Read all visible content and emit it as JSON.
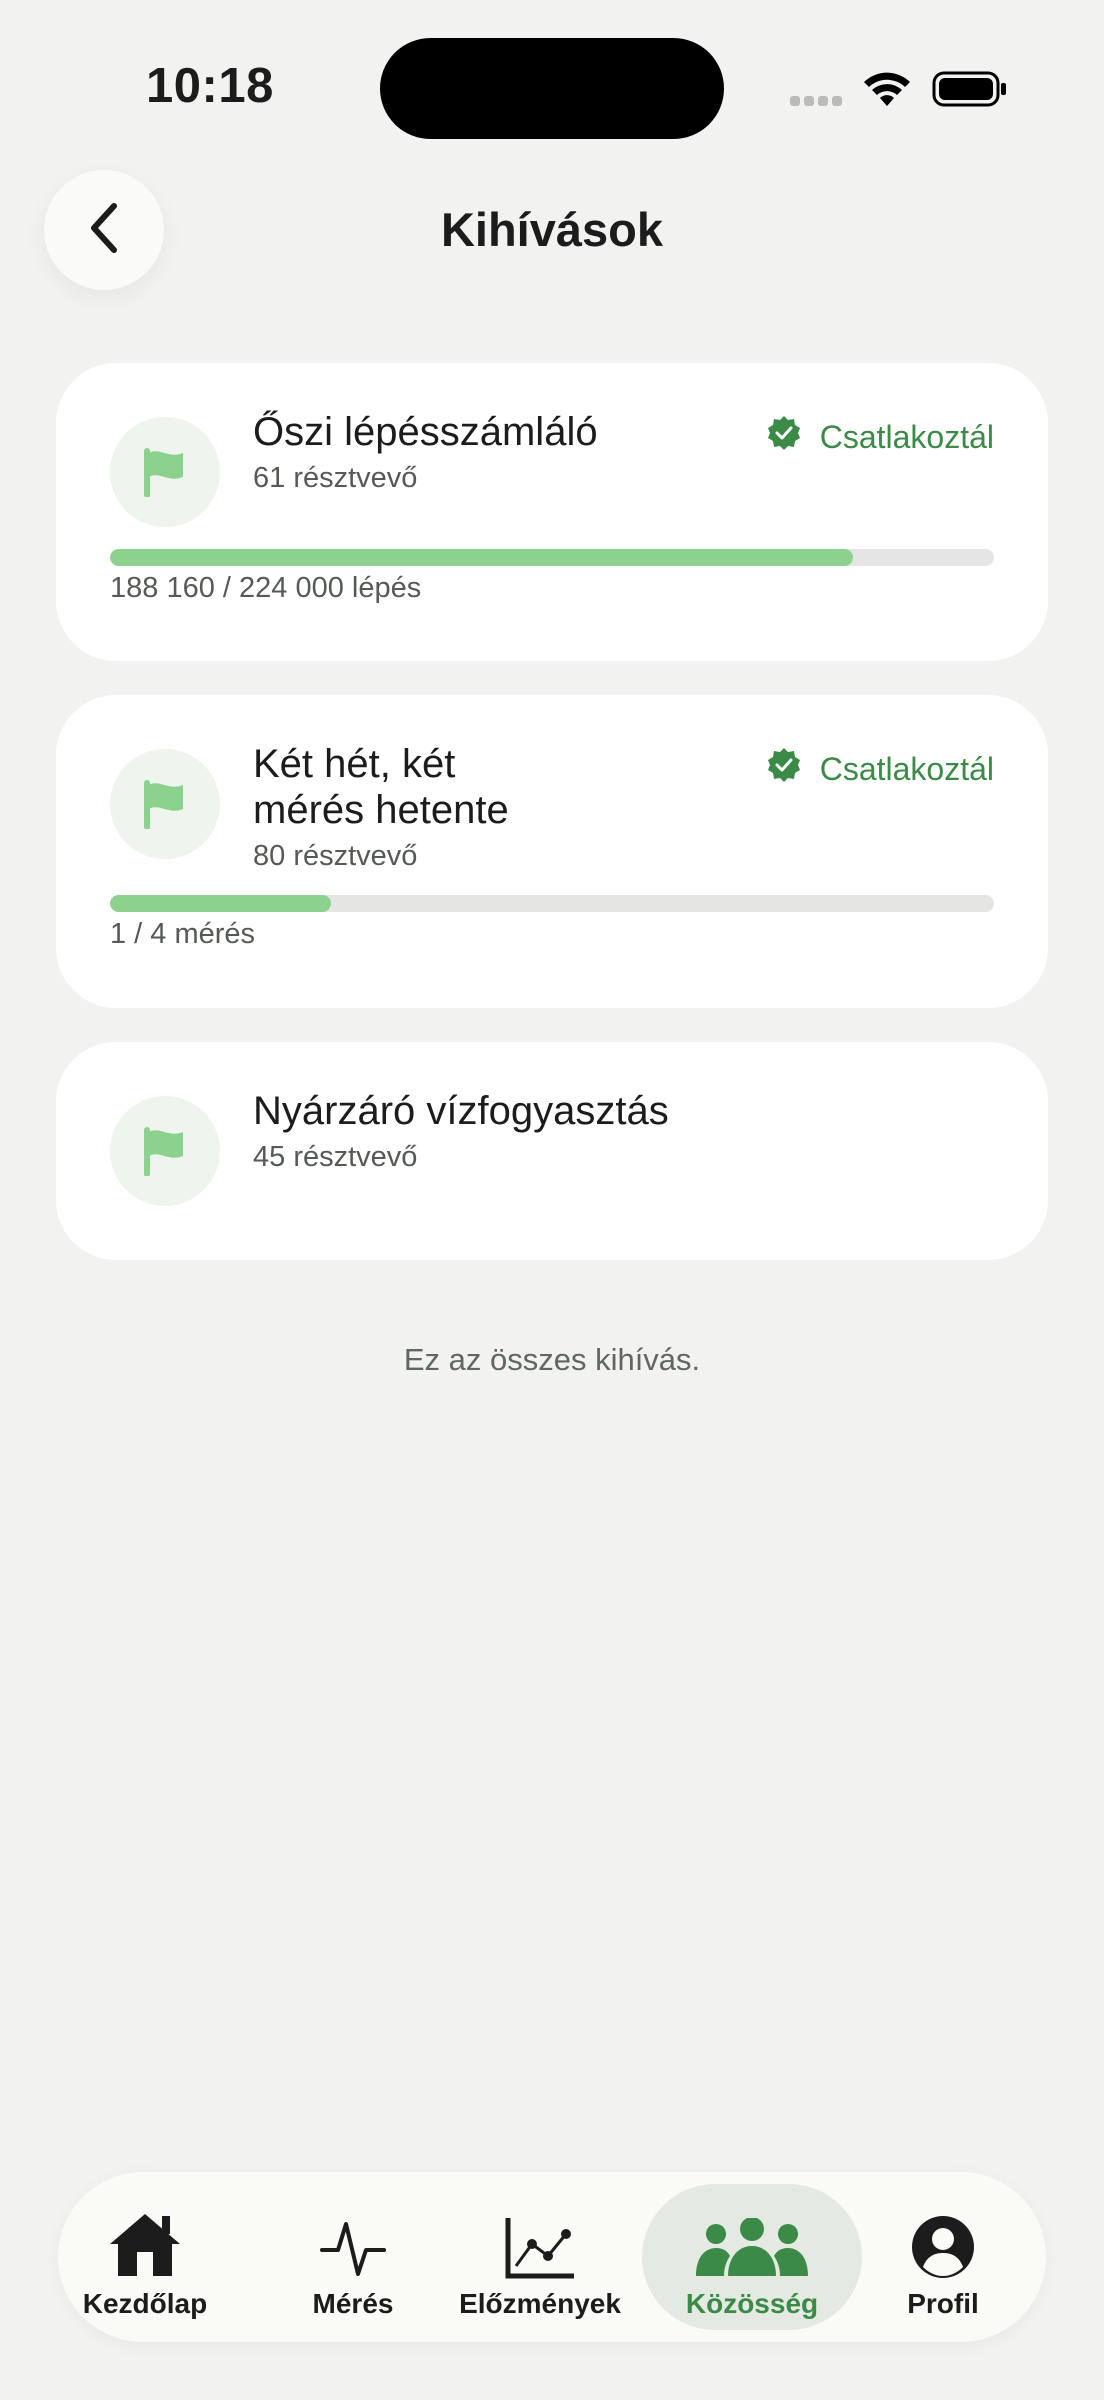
{
  "status_bar": {
    "time": "10:18"
  },
  "header": {
    "title": "Kihívások"
  },
  "challenges": [
    {
      "title": "Őszi lépésszámláló",
      "participants": "61 résztvevő",
      "joined_label": "Csatlakoztál",
      "progress": 0.84,
      "progress_text": "188 160 / 224 000 lépés"
    },
    {
      "title_line1": "Két hét, két",
      "title_line2": "mérés hetente",
      "participants": "80 résztvevő",
      "joined_label": "Csatlakoztál",
      "progress": 0.25,
      "progress_text": "1 / 4 mérés"
    },
    {
      "title": "Nyárzáró vízfogyasztás",
      "participants": "45 résztvevő"
    }
  ],
  "footer_note": "Ez az összes kihívás.",
  "tabs": [
    {
      "label": "Kezdőlap",
      "icon": "home-icon"
    },
    {
      "label": "Mérés",
      "icon": "pulse-icon"
    },
    {
      "label": "Előzmények",
      "icon": "chart-icon"
    },
    {
      "label": "Közösség",
      "icon": "community-icon",
      "active": true
    },
    {
      "label": "Profil",
      "icon": "profile-icon"
    }
  ],
  "colors": {
    "accent": "#3b8a47",
    "progress": "#8cd28e",
    "background": "#f2f3f1"
  }
}
